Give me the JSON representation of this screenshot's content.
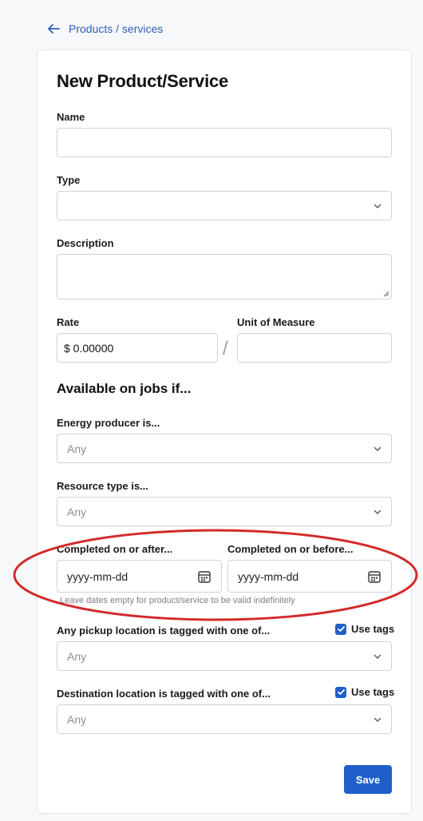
{
  "breadcrumb": {
    "back_label": "Products / services"
  },
  "form": {
    "title": "New Product/Service",
    "name": {
      "label": "Name",
      "value": ""
    },
    "type": {
      "label": "Type",
      "value": ""
    },
    "description": {
      "label": "Description",
      "value": ""
    },
    "rate": {
      "label": "Rate",
      "value": "$ 0.00000"
    },
    "rate_separator": "/",
    "unit_of_measure": {
      "label": "Unit of Measure",
      "value": ""
    }
  },
  "availability": {
    "heading": "Available on jobs if...",
    "energy_producer": {
      "label": "Energy producer is...",
      "value": "Any"
    },
    "resource_type": {
      "label": "Resource type is...",
      "value": "Any"
    },
    "completed_after": {
      "label": "Completed on or after...",
      "placeholder": "yyyy-mm-dd"
    },
    "completed_before": {
      "label": "Completed on or before...",
      "placeholder": "yyyy-mm-dd"
    },
    "date_hint": "Leave dates empty for product/service to be valid indefinitely",
    "pickup_location": {
      "label": "Any pickup location is tagged with one of...",
      "value": "Any",
      "use_tags_label": "Use tags",
      "use_tags_checked": true
    },
    "destination_location": {
      "label": "Destination location is tagged with one of...",
      "value": "Any",
      "use_tags_label": "Use tags",
      "use_tags_checked": true
    }
  },
  "actions": {
    "save_label": "Save"
  },
  "colors": {
    "accent": "#1f5fc9",
    "link": "#2f5fb3",
    "annotation": "#d42a2a"
  }
}
